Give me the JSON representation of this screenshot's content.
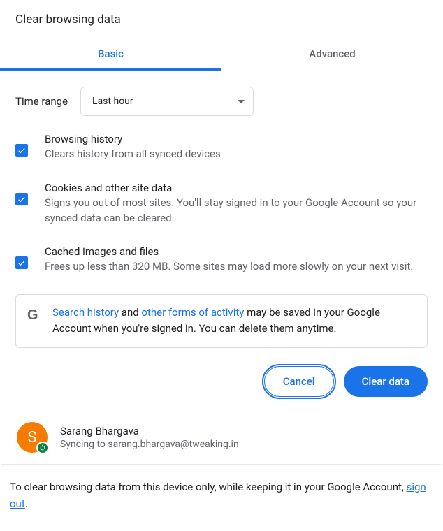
{
  "title": "Clear browsing data",
  "tabs": {
    "basic": "Basic",
    "advanced": "Advanced"
  },
  "time": {
    "label": "Time range",
    "value": "Last hour"
  },
  "items": [
    {
      "title": "Browsing history",
      "desc": "Clears history from all synced devices",
      "checked": true
    },
    {
      "title": "Cookies and other site data",
      "desc": "Signs you out of most sites. You'll stay signed in to your Google Account so your synced data can be cleared.",
      "checked": true
    },
    {
      "title": "Cached images and files",
      "desc": "Frees up less than 320 MB. Some sites may load more slowly on your next visit.",
      "checked": true
    }
  ],
  "info": {
    "link1": "Search history",
    "mid1": " and ",
    "link2": "other forms of activity",
    "mid2": " may be saved in your Google Account when you're signed in. You can delete them anytime."
  },
  "buttons": {
    "cancel": "Cancel",
    "clear": "Clear data"
  },
  "account": {
    "initial": "S",
    "name": "Sarang Bhargava",
    "sync": "Syncing to sarang.bhargava@tweaking.in"
  },
  "footer": {
    "pre": "To clear browsing data from this device only, while keeping it in your Google Account, ",
    "link": "sign out",
    "post": "."
  }
}
